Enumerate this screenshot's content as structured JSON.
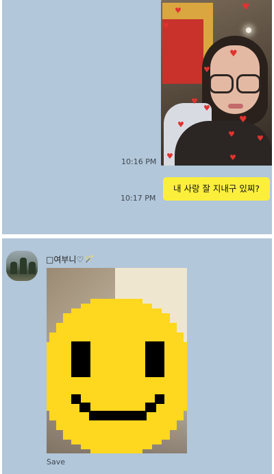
{
  "top_chat": {
    "photo_message": {
      "time": "10:16 PM"
    },
    "text_message": {
      "text": "내 사랑 잘 지내구 있찌?",
      "time": "10:17 PM"
    }
  },
  "bottom_chat": {
    "sender_name": "□여부니♡🪄",
    "photo_message": {
      "save_label": "Save"
    }
  },
  "colors": {
    "chat_background": "#b2c7d9",
    "sent_bubble": "#fcef3c",
    "smiley_yellow": "#fed71f",
    "heart_red": "#e0332f"
  },
  "icons": [
    "heart-icon",
    "smiley-face-sticker"
  ]
}
